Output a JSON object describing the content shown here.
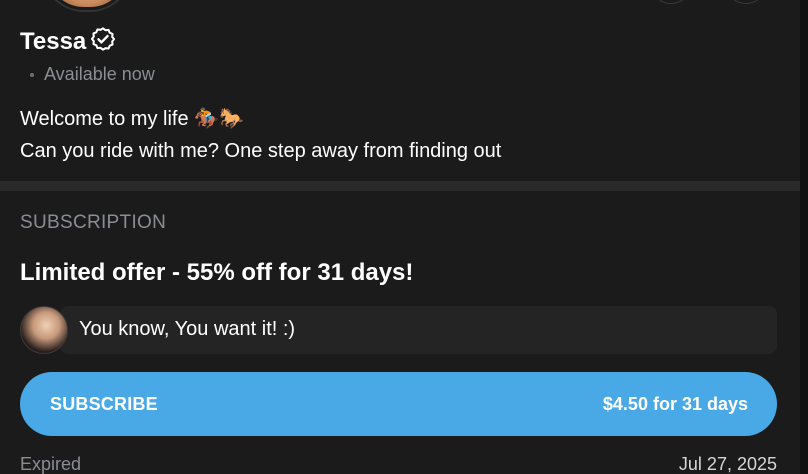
{
  "profile": {
    "name": "Tessa",
    "status": "Available now",
    "bio_line1": "Welcome to my life 🏇🐎",
    "bio_line2": "Can you ride with me? One step away from finding out"
  },
  "subscription": {
    "section_title": "SUBSCRIPTION",
    "offer_text": "Limited offer - 55% off for 31 days!",
    "message": "You know, You want it! :)",
    "button_label": "SUBSCRIBE",
    "button_price": "$4.50 for 31 days",
    "expired_label": "Expired",
    "expired_date": "Jul 27, 2025"
  },
  "icons": {
    "verified": "verified-badge-icon"
  },
  "colors": {
    "background": "#1b1b1b",
    "accent": "#48a9e6",
    "muted_text": "#8a8d93",
    "message_bg": "#242424",
    "divider": "#2a2a2a"
  }
}
